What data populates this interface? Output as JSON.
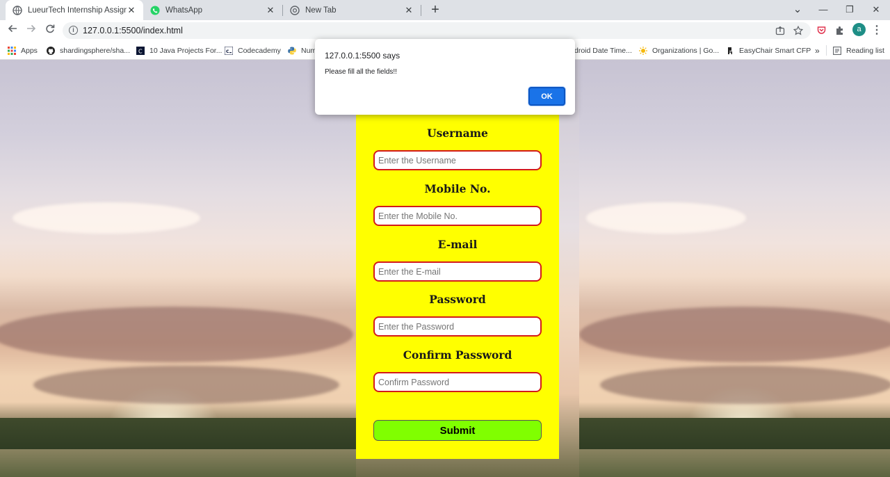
{
  "browser": {
    "tabs": [
      {
        "label": "LueurTech Internship Assignment",
        "icon": "globe-icon",
        "active": true
      },
      {
        "label": "WhatsApp",
        "icon": "whatsapp-icon",
        "active": false
      },
      {
        "label": "New Tab",
        "icon": "chrome-icon",
        "active": false
      }
    ],
    "close_glyph": "✕",
    "new_tab_glyph": "+",
    "address": "127.0.0.1:5500/index.html",
    "profile_initial": "a",
    "window_controls": {
      "minimize": "—",
      "restore": "❐",
      "close": "✕",
      "tab_search": "⌄"
    }
  },
  "bookmarks": {
    "apps": "Apps",
    "items": [
      {
        "label": "shardingsphere/sha...",
        "icon": "github-icon"
      },
      {
        "label": "10 Java Projects For...",
        "icon": "codeforces-icon"
      },
      {
        "label": "Codecademy",
        "icon": "codecademy-icon"
      },
      {
        "label": "Num",
        "icon": "python-icon"
      },
      {
        "label": "droid Date Time...",
        "icon": ""
      },
      {
        "label": "Organizations | Go...",
        "icon": "sun-icon"
      },
      {
        "label": "EasyChair Smart CFP",
        "icon": "easychair-icon"
      }
    ],
    "more": "»",
    "reading_list": "Reading list"
  },
  "form": {
    "fields": [
      {
        "label": "Username",
        "placeholder": "Enter the Username"
      },
      {
        "label": "Mobile No.",
        "placeholder": "Enter the Mobile No."
      },
      {
        "label": "E-mail",
        "placeholder": "Enter the E-mail"
      },
      {
        "label": "Password",
        "placeholder": "Enter the Password"
      },
      {
        "label": "Confirm Password",
        "placeholder": "Confirm Password"
      }
    ],
    "submit_label": "Submit",
    "panel_color": "#ffff00",
    "input_border_color": "#d31a1a",
    "submit_color": "#80ff00"
  },
  "dialog": {
    "title": "127.0.0.1:5500 says",
    "message": "Please fill all the fields!!",
    "ok_label": "OK"
  }
}
